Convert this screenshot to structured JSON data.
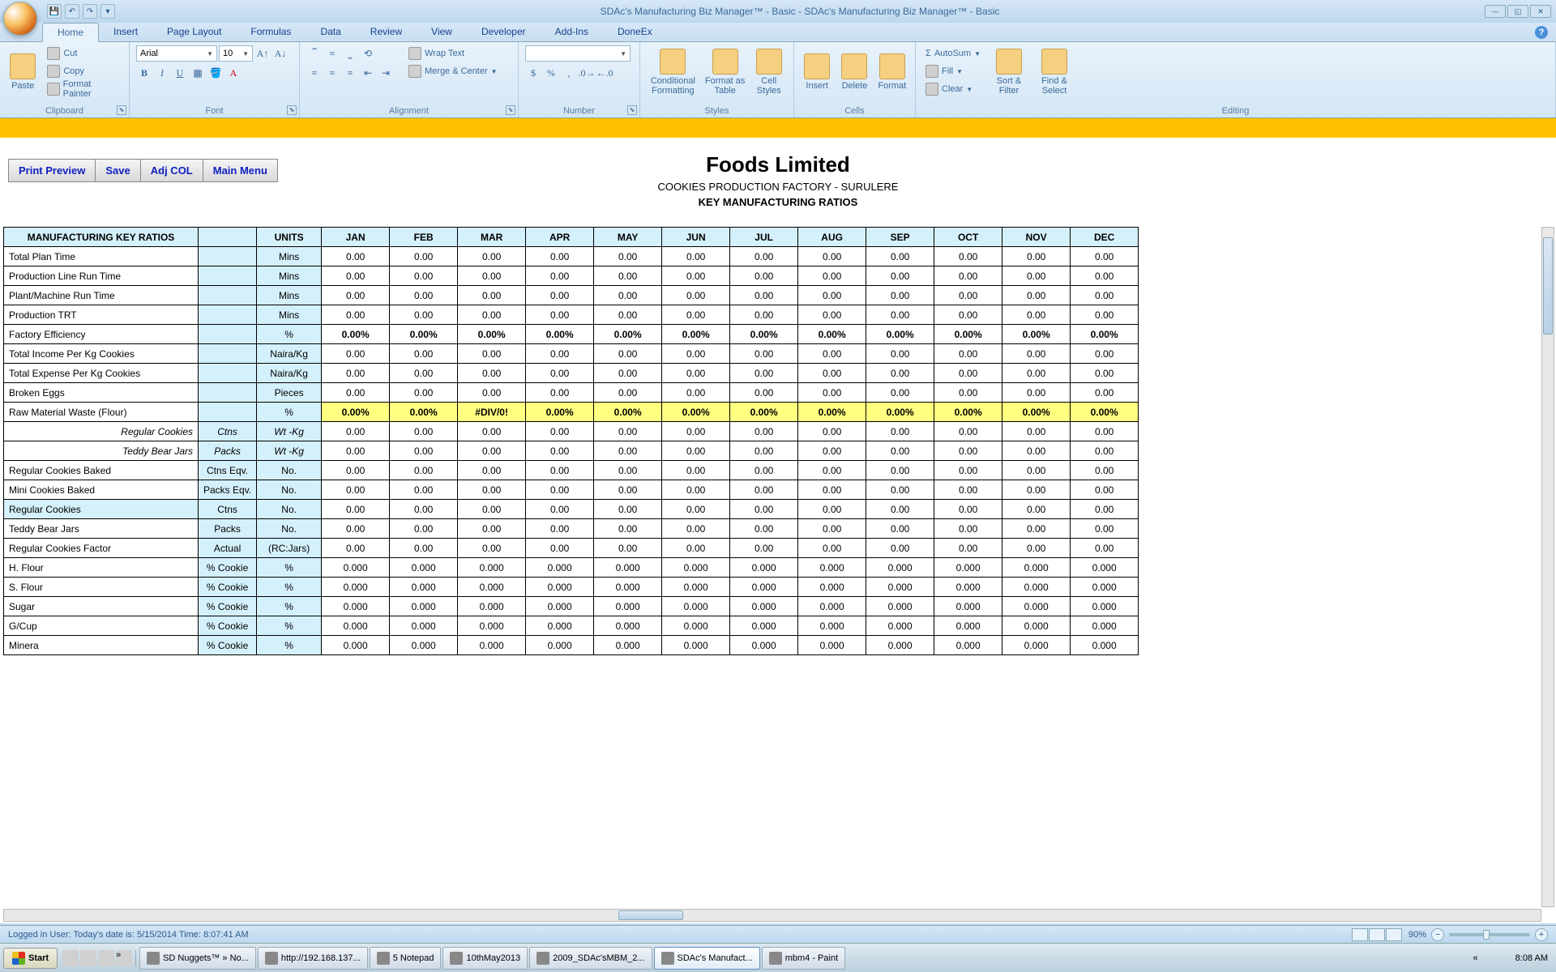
{
  "title_bar": {
    "title": "SDAc's Manufacturing Biz Manager™ - Basic - SDAc's Manufacturing Biz Manager™ - Basic"
  },
  "ribbon_tabs": [
    "Home",
    "Insert",
    "Page Layout",
    "Formulas",
    "Data",
    "Review",
    "View",
    "Developer",
    "Add-Ins",
    "DoneEx"
  ],
  "active_tab": "Home",
  "clipboard": {
    "paste": "Paste",
    "cut": "Cut",
    "copy": "Copy",
    "format_painter": "Format Painter",
    "label": "Clipboard"
  },
  "font": {
    "name": "Arial",
    "size": "10",
    "label": "Font"
  },
  "alignment": {
    "wrap": "Wrap Text",
    "merge": "Merge & Center",
    "label": "Alignment"
  },
  "number": {
    "label": "Number"
  },
  "styles": {
    "cond": "Conditional Formatting",
    "table": "Format as Table",
    "cell": "Cell Styles",
    "label": "Styles"
  },
  "cells": {
    "insert": "Insert",
    "delete": "Delete",
    "format": "Format",
    "label": "Cells"
  },
  "editing": {
    "autosum": "AutoSum",
    "fill": "Fill",
    "clear": "Clear",
    "sort": "Sort & Filter",
    "find": "Find & Select",
    "label": "Editing"
  },
  "doc_buttons": [
    "Print Preview",
    "Save",
    "Adj COL",
    "Main Menu"
  ],
  "report": {
    "title": "Foods Limited",
    "sub": "COOKIES PRODUCTION FACTORY - SURULERE",
    "sub2": "KEY MANUFACTURING RATIOS"
  },
  "table": {
    "head": [
      "MANUFACTURING KEY RATIOS",
      "",
      "UNITS",
      "JAN",
      "FEB",
      "MAR",
      "APR",
      "MAY",
      "JUN",
      "JUL",
      "AUG",
      "SEP",
      "OCT",
      "NOV",
      "DEC"
    ],
    "rows": [
      {
        "label": "Total Plan Time",
        "sub": "",
        "units": "Mins",
        "vals": [
          "0.00",
          "0.00",
          "0.00",
          "0.00",
          "0.00",
          "0.00",
          "0.00",
          "0.00",
          "0.00",
          "0.00",
          "0.00",
          "0.00"
        ],
        "style": ""
      },
      {
        "label": "Production Line Run Time",
        "sub": "",
        "units": "Mins",
        "vals": [
          "0.00",
          "0.00",
          "0.00",
          "0.00",
          "0.00",
          "0.00",
          "0.00",
          "0.00",
          "0.00",
          "0.00",
          "0.00",
          "0.00"
        ],
        "style": ""
      },
      {
        "label": "Plant/Machine Run Time",
        "sub": "",
        "units": "Mins",
        "vals": [
          "0.00",
          "0.00",
          "0.00",
          "0.00",
          "0.00",
          "0.00",
          "0.00",
          "0.00",
          "0.00",
          "0.00",
          "0.00",
          "0.00"
        ],
        "style": ""
      },
      {
        "label": "Production TRT",
        "sub": "",
        "units": "Mins",
        "vals": [
          "0.00",
          "0.00",
          "0.00",
          "0.00",
          "0.00",
          "0.00",
          "0.00",
          "0.00",
          "0.00",
          "0.00",
          "0.00",
          "0.00"
        ],
        "style": ""
      },
      {
        "label": "Factory Efficiency",
        "sub": "",
        "units": "%",
        "vals": [
          "0.00%",
          "0.00%",
          "0.00%",
          "0.00%",
          "0.00%",
          "0.00%",
          "0.00%",
          "0.00%",
          "0.00%",
          "0.00%",
          "0.00%",
          "0.00%"
        ],
        "style": "bold"
      },
      {
        "label": "Total Income Per Kg Cookies",
        "sub": "",
        "units": "Naira/Kg",
        "vals": [
          "0.00",
          "0.00",
          "0.00",
          "0.00",
          "0.00",
          "0.00",
          "0.00",
          "0.00",
          "0.00",
          "0.00",
          "0.00",
          "0.00"
        ],
        "style": ""
      },
      {
        "label": "Total Expense Per Kg Cookies",
        "sub": "",
        "units": "Naira/Kg",
        "vals": [
          "0.00",
          "0.00",
          "0.00",
          "0.00",
          "0.00",
          "0.00",
          "0.00",
          "0.00",
          "0.00",
          "0.00",
          "0.00",
          "0.00"
        ],
        "style": ""
      },
      {
        "label": "Broken Eggs",
        "sub": "",
        "units": "Pieces",
        "vals": [
          "0.00",
          "0.00",
          "0.00",
          "0.00",
          "0.00",
          "0.00",
          "0.00",
          "0.00",
          "0.00",
          "0.00",
          "0.00",
          "0.00"
        ],
        "style": ""
      },
      {
        "label": "Raw Material Waste (Flour)",
        "sub": "",
        "units": "%",
        "vals": [
          "0.00%",
          "0.00%",
          "#DIV/0!",
          "0.00%",
          "0.00%",
          "0.00%",
          "0.00%",
          "0.00%",
          "0.00%",
          "0.00%",
          "0.00%",
          "0.00%"
        ],
        "style": "yellow"
      },
      {
        "label": "Regular Cookies",
        "sub": "Ctns",
        "units": "Wt -Kg",
        "vals": [
          "0.00",
          "0.00",
          "0.00",
          "0.00",
          "0.00",
          "0.00",
          "0.00",
          "0.00",
          "0.00",
          "0.00",
          "0.00",
          "0.00"
        ],
        "style": "italic"
      },
      {
        "label": "Teddy Bear Jars",
        "sub": "Packs",
        "units": "Wt -Kg",
        "vals": [
          "0.00",
          "0.00",
          "0.00",
          "0.00",
          "0.00",
          "0.00",
          "0.00",
          "0.00",
          "0.00",
          "0.00",
          "0.00",
          "0.00"
        ],
        "style": "italic"
      },
      {
        "label": "Regular Cookies Baked",
        "sub": "Ctns Eqv.",
        "units": "No.",
        "vals": [
          "0.00",
          "0.00",
          "0.00",
          "0.00",
          "0.00",
          "0.00",
          "0.00",
          "0.00",
          "0.00",
          "0.00",
          "0.00",
          "0.00"
        ],
        "style": ""
      },
      {
        "label": "Mini Cookies Baked",
        "sub": "Packs Eqv.",
        "units": "No.",
        "vals": [
          "0.00",
          "0.00",
          "0.00",
          "0.00",
          "0.00",
          "0.00",
          "0.00",
          "0.00",
          "0.00",
          "0.00",
          "0.00",
          "0.00"
        ],
        "style": ""
      },
      {
        "label": "Regular Cookies",
        "sub": "Ctns",
        "units": "No.",
        "vals": [
          "0.00",
          "0.00",
          "0.00",
          "0.00",
          "0.00",
          "0.00",
          "0.00",
          "0.00",
          "0.00",
          "0.00",
          "0.00",
          "0.00"
        ],
        "style": "blue"
      },
      {
        "label": "Teddy Bear Jars",
        "sub": "Packs",
        "units": "No.",
        "vals": [
          "0.00",
          "0.00",
          "0.00",
          "0.00",
          "0.00",
          "0.00",
          "0.00",
          "0.00",
          "0.00",
          "0.00",
          "0.00",
          "0.00"
        ],
        "style": ""
      },
      {
        "label": "Regular Cookies Factor",
        "sub": "Actual",
        "units": "(RC:Jars)",
        "vals": [
          "0.00",
          "0.00",
          "0.00",
          "0.00",
          "0.00",
          "0.00",
          "0.00",
          "0.00",
          "0.00",
          "0.00",
          "0.00",
          "0.00"
        ],
        "style": ""
      },
      {
        "label": "H. Flour",
        "sub": "% Cookie",
        "units": "%",
        "vals": [
          "0.000",
          "0.000",
          "0.000",
          "0.000",
          "0.000",
          "0.000",
          "0.000",
          "0.000",
          "0.000",
          "0.000",
          "0.000",
          "0.000"
        ],
        "style": ""
      },
      {
        "label": "S. Flour",
        "sub": "% Cookie",
        "units": "%",
        "vals": [
          "0.000",
          "0.000",
          "0.000",
          "0.000",
          "0.000",
          "0.000",
          "0.000",
          "0.000",
          "0.000",
          "0.000",
          "0.000",
          "0.000"
        ],
        "style": ""
      },
      {
        "label": "Sugar",
        "sub": "% Cookie",
        "units": "%",
        "vals": [
          "0.000",
          "0.000",
          "0.000",
          "0.000",
          "0.000",
          "0.000",
          "0.000",
          "0.000",
          "0.000",
          "0.000",
          "0.000",
          "0.000"
        ],
        "style": ""
      },
      {
        "label": "G/Cup",
        "sub": "% Cookie",
        "units": "%",
        "vals": [
          "0.000",
          "0.000",
          "0.000",
          "0.000",
          "0.000",
          "0.000",
          "0.000",
          "0.000",
          "0.000",
          "0.000",
          "0.000",
          "0.000"
        ],
        "style": ""
      },
      {
        "label": "Minera",
        "sub": "% Cookie",
        "units": "%",
        "vals": [
          "0.000",
          "0.000",
          "0.000",
          "0.000",
          "0.000",
          "0.000",
          "0.000",
          "0.000",
          "0.000",
          "0.000",
          "0.000",
          "0.000"
        ],
        "style": ""
      }
    ]
  },
  "status": {
    "text": "Logged in User:  Today's date is: 5/15/2014 Time: 8:07:41 AM",
    "zoom": "90%"
  },
  "taskbar": {
    "start": "Start",
    "items": [
      {
        "label": "SD Nuggets™ » No...",
        "active": false
      },
      {
        "label": "http://192.168.137...",
        "active": false
      },
      {
        "label": "5 Notepad",
        "active": false
      },
      {
        "label": "10thMay2013",
        "active": false
      },
      {
        "label": "2009_SDAc'sMBM_2...",
        "active": false
      },
      {
        "label": "SDAc's Manufact...",
        "active": true
      },
      {
        "label": "mbm4 - Paint",
        "active": false
      }
    ],
    "clock": "8:08 AM"
  }
}
